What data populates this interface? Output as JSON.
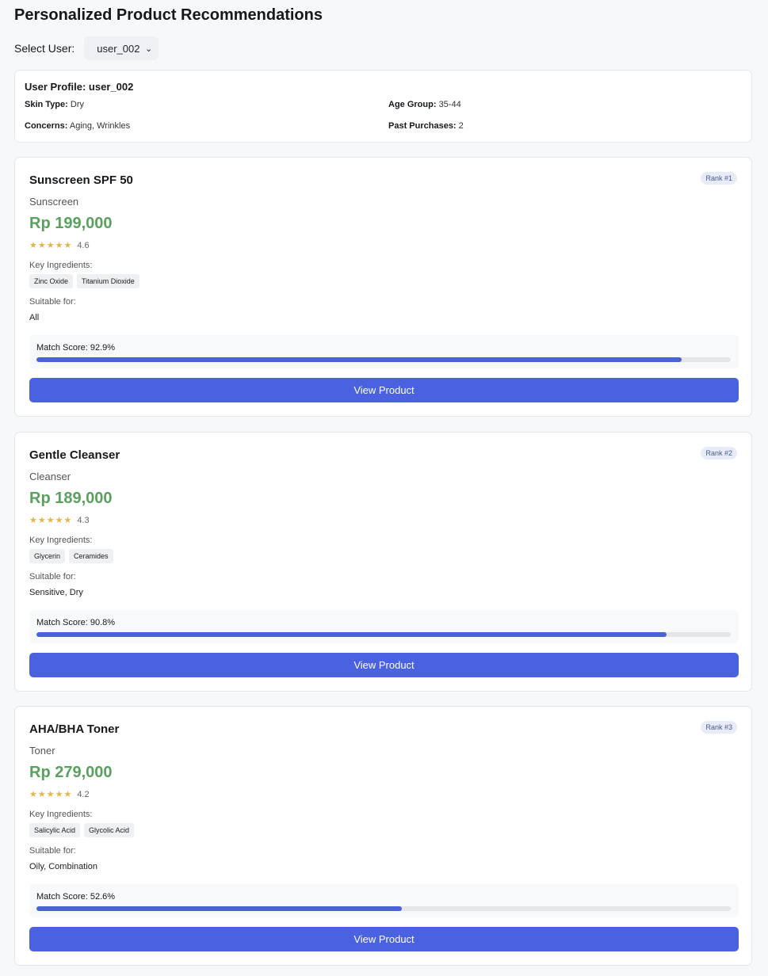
{
  "page": {
    "title": "Personalized Product Recommendations"
  },
  "selector": {
    "label": "Select User:",
    "value": "user_002"
  },
  "profile": {
    "title": "User Profile: user_002",
    "skin_type_label": "Skin Type:",
    "skin_type": "Dry",
    "age_group_label": "Age Group:",
    "age_group": "35-44",
    "concerns_label": "Concerns:",
    "concerns": "Aging, Wrinkles",
    "past_purchases_label": "Past Purchases:",
    "past_purchases": "2"
  },
  "labels": {
    "key_ingredients": "Key Ingredients:",
    "suitable_for": "Suitable for:",
    "view_product": "View Product"
  },
  "colors": {
    "accent": "#4a62e0",
    "price": "#5aa05e",
    "stars": "#e6b54a"
  },
  "products": [
    {
      "name": "Sunscreen SPF 50",
      "category": "Sunscreen",
      "price": "Rp 199,000",
      "stars": "★★★★★",
      "rating": "4.6",
      "ingredients": [
        "Zinc Oxide",
        "Titanium Dioxide"
      ],
      "suitable": "All",
      "rank": "Rank #1",
      "match_text": "Match Score: 92.9%",
      "match_score": 92.9
    },
    {
      "name": "Gentle Cleanser",
      "category": "Cleanser",
      "price": "Rp 189,000",
      "stars": "★★★★★",
      "rating": "4.3",
      "ingredients": [
        "Glycerin",
        "Ceramides"
      ],
      "suitable": "Sensitive, Dry",
      "rank": "Rank #2",
      "match_text": "Match Score: 90.8%",
      "match_score": 90.8
    },
    {
      "name": "AHA/BHA Toner",
      "category": "Toner",
      "price": "Rp 279,000",
      "stars": "★★★★★",
      "rating": "4.2",
      "ingredients": [
        "Salicylic Acid",
        "Glycolic Acid"
      ],
      "suitable": "Oily, Combination",
      "rank": "Rank #3",
      "match_text": "Match Score: 52.6%",
      "match_score": 52.6
    }
  ]
}
